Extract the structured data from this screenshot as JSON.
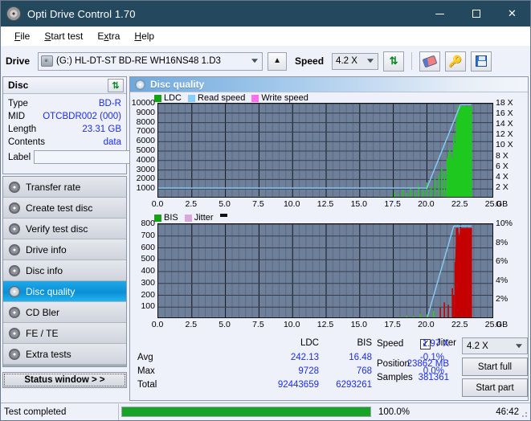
{
  "window": {
    "title": "Opti Drive Control 1.70",
    "app_icon": "disc-icon",
    "minimize": "minimize-icon",
    "maximize": "maximize-icon",
    "close": "close-icon"
  },
  "menu": [
    {
      "label": "File",
      "accel": "F"
    },
    {
      "label": "Start test",
      "accel": "S"
    },
    {
      "label": "Extra",
      "accel": "x"
    },
    {
      "label": "Help",
      "accel": "H"
    }
  ],
  "toolbar": {
    "drive_label": "Drive",
    "drive_value": "(G:)  HL-DT-ST BD-RE  WH16NS48 1.D3",
    "eject_icon": "eject-icon",
    "speed_label": "Speed",
    "speed_value": "4.2 X",
    "refresh_icon": "refresh-icon",
    "eraser_icon": "eraser-icon",
    "key_icon": "key-icon",
    "save_icon": "save-icon"
  },
  "disc": {
    "title": "Disc",
    "refresh_icon": "refresh-icon",
    "rows": [
      {
        "label": "Type",
        "value": "BD-R"
      },
      {
        "label": "MID",
        "value": "OTCBDR002 (000)"
      },
      {
        "label": "Length",
        "value": "23.31 GB"
      },
      {
        "label": "Contents",
        "value": "data"
      }
    ],
    "label_label": "Label",
    "label_value": "",
    "label_placeholder": "",
    "disc_icon": "disc-icon"
  },
  "nav": {
    "items": [
      {
        "label": "Transfer rate",
        "selected": false,
        "icon": "disc-icon"
      },
      {
        "label": "Create test disc",
        "selected": false,
        "icon": "disc-icon"
      },
      {
        "label": "Verify test disc",
        "selected": false,
        "icon": "disc-icon"
      },
      {
        "label": "Drive info",
        "selected": false,
        "icon": "disc-icon"
      },
      {
        "label": "Disc info",
        "selected": false,
        "icon": "disc-icon"
      },
      {
        "label": "Disc quality",
        "selected": true,
        "icon": "disc-icon"
      },
      {
        "label": "CD Bler",
        "selected": false,
        "icon": "disc-icon"
      },
      {
        "label": "FE / TE",
        "selected": false,
        "icon": "disc-icon"
      },
      {
        "label": "Extra tests",
        "selected": false,
        "icon": "disc-icon"
      }
    ],
    "status_window": "Status window > >"
  },
  "main": {
    "header_title": "Disc quality",
    "header_icon": "disc-icon"
  },
  "stats": {
    "col_headers": [
      "LDC",
      "BIS"
    ],
    "row_labels": [
      "Avg",
      "Max",
      "Total"
    ],
    "ldc": {
      "avg": "242.13",
      "max": "9728",
      "total": "92443659"
    },
    "bis": {
      "avg": "16.48",
      "max": "768",
      "total": "6293261"
    },
    "jitter": {
      "label": "Jitter",
      "checked": true,
      "avg": "-0.1%",
      "max": "0.0%"
    },
    "speed_label": "Speed",
    "speed_value": "1.97 X",
    "speed_select": "4.2 X",
    "position_label": "Position",
    "position_value": "23862 MB",
    "samples_label": "Samples",
    "samples_value": "381361",
    "start_full": "Start full",
    "start_part": "Start part"
  },
  "statusbar": {
    "text": "Test completed",
    "progress_pct": 100.0,
    "progress_text": "100.0%",
    "elapsed": "46:42"
  },
  "chart_data": [
    {
      "type": "area",
      "name": "ldc-chart",
      "title": "",
      "xlabel": "GB",
      "ylabel": "",
      "xlim": [
        0,
        25
      ],
      "ylim": [
        0,
        10000
      ],
      "y2lim": [
        0,
        18
      ],
      "y2label": "X",
      "grid": true,
      "legend_position": "top-left",
      "xticks": [
        "0.0",
        "2.5",
        "5.0",
        "7.5",
        "10.0",
        "12.5",
        "15.0",
        "17.5",
        "20.0",
        "22.5",
        "25.0"
      ],
      "yticks": [
        "1000",
        "2000",
        "3000",
        "4000",
        "5000",
        "6000",
        "7000",
        "8000",
        "9000",
        "10000"
      ],
      "y2ticks": [
        "2 X",
        "4 X",
        "6 X",
        "8 X",
        "10 X",
        "12 X",
        "14 X",
        "16 X",
        "18 X"
      ],
      "x_unit_label": "GB",
      "series": [
        {
          "name": "LDC",
          "color": "#1ec81e",
          "type": "bar"
        },
        {
          "name": "Read speed",
          "color": "#87cefa",
          "type": "line"
        },
        {
          "name": "Write speed",
          "color": "#ff6ef0",
          "type": "line"
        }
      ],
      "ldc_points": [
        [
          0.0,
          40
        ],
        [
          0.5,
          55
        ],
        [
          1.0,
          45
        ],
        [
          1.5,
          60
        ],
        [
          2.0,
          50
        ],
        [
          2.5,
          120
        ],
        [
          3.0,
          70
        ],
        [
          3.4,
          160
        ],
        [
          3.8,
          90
        ],
        [
          4.2,
          210
        ],
        [
          4.6,
          80
        ],
        [
          5.0,
          130
        ],
        [
          5.5,
          70
        ],
        [
          6.0,
          190
        ],
        [
          6.5,
          85
        ],
        [
          7.0,
          60
        ],
        [
          7.5,
          230
        ],
        [
          8.0,
          75
        ],
        [
          8.5,
          140
        ],
        [
          9.0,
          65
        ],
        [
          9.5,
          200
        ],
        [
          10.0,
          90
        ],
        [
          10.5,
          70
        ],
        [
          11.0,
          160
        ],
        [
          11.5,
          80
        ],
        [
          12.0,
          120
        ],
        [
          12.5,
          70
        ],
        [
          13.0,
          230
        ],
        [
          13.5,
          95
        ],
        [
          14.0,
          75
        ],
        [
          14.5,
          180
        ],
        [
          15.0,
          85
        ],
        [
          15.5,
          130
        ],
        [
          16.0,
          70
        ],
        [
          16.5,
          260
        ],
        [
          17.0,
          110
        ],
        [
          17.3,
          340
        ],
        [
          17.6,
          700
        ],
        [
          17.9,
          450
        ],
        [
          18.2,
          900
        ],
        [
          18.5,
          620
        ],
        [
          18.8,
          1150
        ],
        [
          19.1,
          760
        ],
        [
          19.4,
          1400
        ],
        [
          19.7,
          980
        ],
        [
          20.0,
          1700
        ],
        [
          20.3,
          1250
        ],
        [
          20.6,
          2100
        ],
        [
          20.9,
          2600
        ],
        [
          21.1,
          3300
        ],
        [
          21.3,
          2800
        ],
        [
          21.5,
          4200
        ],
        [
          21.7,
          5300
        ],
        [
          21.9,
          4000
        ],
        [
          22.0,
          6900
        ],
        [
          22.1,
          5400
        ],
        [
          22.2,
          8200
        ],
        [
          22.3,
          9728
        ],
        [
          22.4,
          9000
        ],
        [
          22.5,
          9728
        ],
        [
          22.6,
          9728
        ],
        [
          22.8,
          9728
        ],
        [
          23.0,
          9728
        ],
        [
          23.2,
          9728
        ],
        [
          23.31,
          9728
        ]
      ],
      "read_speed_points": [
        [
          0.0,
          1.97
        ],
        [
          5.0,
          1.97
        ],
        [
          10.0,
          1.97
        ],
        [
          15.0,
          1.97
        ],
        [
          20.0,
          1.97
        ],
        [
          22.5,
          17.8
        ],
        [
          23.31,
          17.8
        ]
      ]
    },
    {
      "type": "area",
      "name": "bis-jitter-chart",
      "title": "",
      "xlabel": "GB",
      "ylabel": "",
      "xlim": [
        0,
        25
      ],
      "ylim": [
        0,
        800
      ],
      "y2lim": [
        0,
        10
      ],
      "y2label": "%",
      "grid": true,
      "legend_position": "top-left",
      "xticks": [
        "0.0",
        "2.5",
        "5.0",
        "7.5",
        "10.0",
        "12.5",
        "15.0",
        "17.5",
        "20.0",
        "22.5",
        "25.0"
      ],
      "yticks": [
        "100",
        "200",
        "300",
        "400",
        "500",
        "600",
        "700",
        "800"
      ],
      "y2ticks": [
        "2%",
        "4%",
        "6%",
        "8%",
        "10%"
      ],
      "x_unit_label": "GB",
      "series": [
        {
          "name": "BIS",
          "color": "#1ec81e",
          "type": "bar"
        },
        {
          "name": "Jitter",
          "color": "#d9a8d9",
          "type": "line"
        }
      ],
      "bis_points": [
        [
          0.0,
          4
        ],
        [
          1.0,
          6
        ],
        [
          2.0,
          5
        ],
        [
          3.0,
          8
        ],
        [
          4.0,
          6
        ],
        [
          5.0,
          10
        ],
        [
          6.0,
          5
        ],
        [
          7.0,
          9
        ],
        [
          8.0,
          6
        ],
        [
          9.0,
          12
        ],
        [
          10.0,
          7
        ],
        [
          11.0,
          6
        ],
        [
          12.0,
          11
        ],
        [
          13.0,
          7
        ],
        [
          14.0,
          9
        ],
        [
          15.0,
          6
        ],
        [
          16.0,
          14
        ],
        [
          17.0,
          9
        ],
        [
          18.0,
          22
        ],
        [
          18.5,
          30
        ],
        [
          19.0,
          26
        ],
        [
          19.5,
          45
        ],
        [
          20.0,
          38
        ],
        [
          20.5,
          70
        ],
        [
          21.0,
          95
        ],
        [
          21.3,
          140
        ],
        [
          21.6,
          120
        ],
        [
          21.9,
          260
        ],
        [
          22.0,
          200
        ],
        [
          22.1,
          480
        ],
        [
          22.2,
          768
        ],
        [
          22.3,
          768
        ],
        [
          22.4,
          700
        ],
        [
          22.5,
          768
        ],
        [
          22.7,
          768
        ],
        [
          23.0,
          768
        ],
        [
          23.31,
          768
        ]
      ],
      "jitter_points": [
        [
          0.0,
          0
        ],
        [
          5.0,
          0
        ],
        [
          10.0,
          0
        ],
        [
          15.0,
          0
        ],
        [
          20.0,
          0
        ],
        [
          22.0,
          9.8
        ],
        [
          23.31,
          9.8
        ]
      ]
    }
  ]
}
